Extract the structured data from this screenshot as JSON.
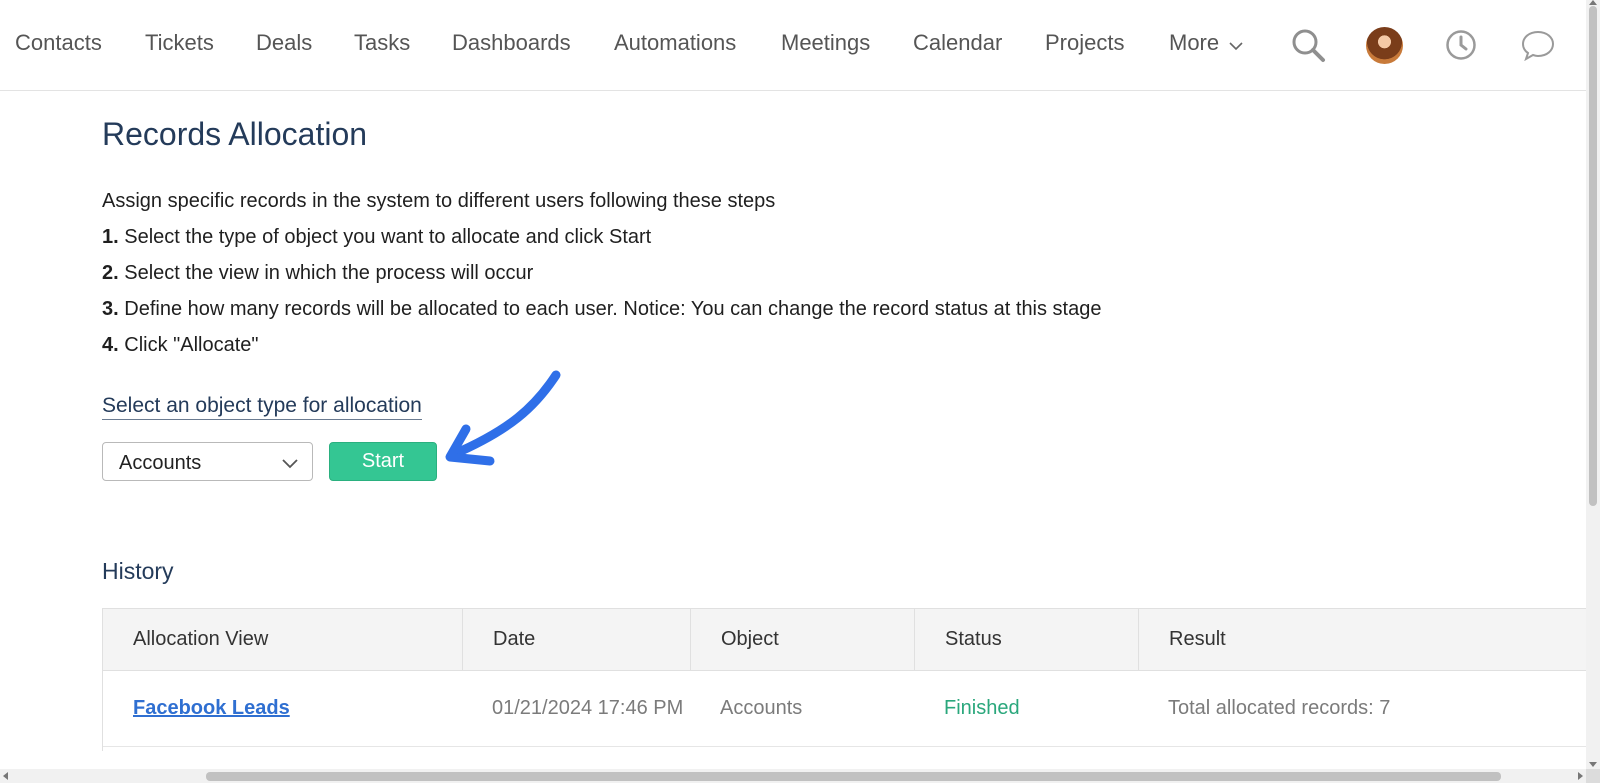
{
  "nav": {
    "items": [
      "Contacts",
      "Tickets",
      "Deals",
      "Tasks",
      "Dashboards",
      "Automations",
      "Meetings",
      "Calendar",
      "Projects"
    ],
    "more_label": "More",
    "icons": [
      "search-icon",
      "avatar",
      "clock-icon",
      "chat-icon"
    ]
  },
  "page": {
    "title": "Records Allocation",
    "intro": "Assign specific records in the system to different users following these steps",
    "steps": [
      {
        "num": "1.",
        "text": "Select the type of object you want to allocate and click Start"
      },
      {
        "num": "2.",
        "text": "Select the view in which the process will occur"
      },
      {
        "num": "3.",
        "text": "Define how many records will be allocated to each user. Notice: You can change the record status at this stage"
      },
      {
        "num": "4.",
        "text": "Click \"Allocate\""
      }
    ],
    "select_label": "Select an object type for allocation",
    "select_value": "Accounts",
    "start_label": "Start"
  },
  "history": {
    "title": "History",
    "columns": [
      "Allocation View",
      "Date",
      "Object",
      "Status",
      "Result"
    ],
    "rows": [
      {
        "view": "Facebook Leads",
        "date": "01/21/2024 17:46 PM",
        "object": "Accounts",
        "status": "Finished",
        "result": "Total allocated records: 7"
      }
    ]
  },
  "colors": {
    "accent_green": "#34c693",
    "title_navy": "#243b5a",
    "link_blue": "#2f6fd1",
    "status_green": "#2aa77c",
    "annotation_arrow": "#2f6fe8"
  }
}
